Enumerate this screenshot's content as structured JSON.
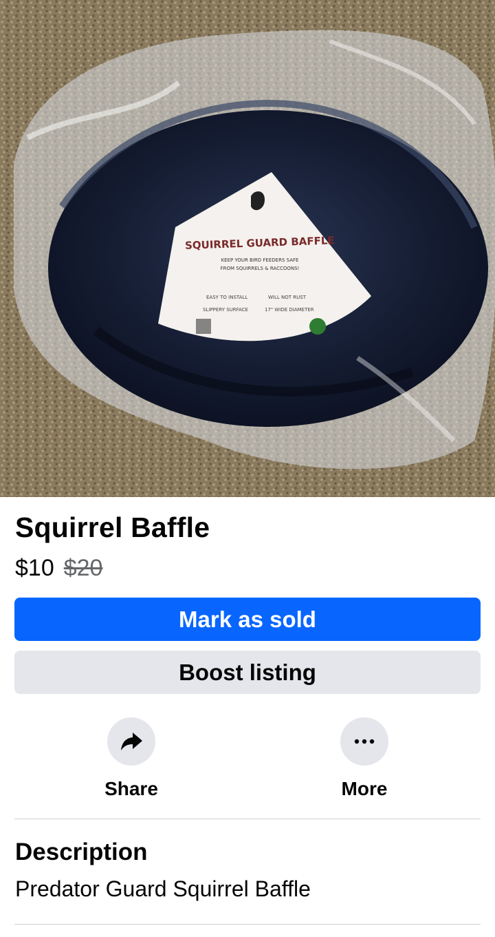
{
  "listing": {
    "title": "Squirrel Baffle",
    "price": "$10",
    "original_price": "$20"
  },
  "photo": {
    "label_heading": "SQUIRREL GUARD BAFFLE",
    "label_tagline_1": "KEEP YOUR BIRD FEEDERS SAFE",
    "label_tagline_2": "FROM SQUIRRELS & RACCOONS!",
    "label_feature_1": "EASY TO INSTALL",
    "label_feature_2": "WILL NOT RUST",
    "label_feature_3": "SLIPPERY SURFACE",
    "label_feature_4": "17\" WIDE DIAMETER"
  },
  "buttons": {
    "mark_sold": "Mark as sold",
    "boost": "Boost listing"
  },
  "actions": {
    "share": "Share",
    "more": "More"
  },
  "description": {
    "heading": "Description",
    "text": "Predator Guard Squirrel Baffle"
  },
  "colors": {
    "primary": "#0866ff",
    "secondary_bg": "#e4e6eb",
    "text": "#050505",
    "muted": "#65676b"
  },
  "icons": {
    "share": "share-arrow-icon",
    "more": "ellipsis-icon"
  }
}
